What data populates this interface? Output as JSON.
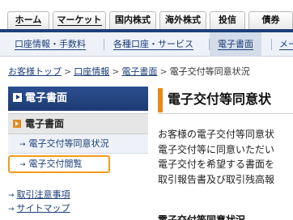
{
  "top_nav": {
    "tabs": [
      {
        "label": "ホーム"
      },
      {
        "label": "マーケット"
      },
      {
        "label": "国内株式"
      },
      {
        "label": "海外株式"
      },
      {
        "label": "投信"
      },
      {
        "label": "債券"
      }
    ]
  },
  "sub_nav": {
    "items": [
      {
        "label": "口座情報・手数料"
      },
      {
        "label": "各種口座・サービス"
      },
      {
        "label": "電子書面"
      },
      {
        "label": "メー"
      }
    ]
  },
  "breadcrumb": {
    "items": [
      "お客様トップ",
      "口座情報",
      "電子書面",
      "電子交付等同意状況"
    ],
    "separator": ">"
  },
  "sidebar": {
    "header": "電子書面",
    "group": "電子書面",
    "items": [
      {
        "label": "電子交付等同意状況"
      },
      {
        "label": "電子交付閲覧"
      }
    ],
    "links": [
      {
        "label": "取引注意事項"
      },
      {
        "label": "サイトマップ"
      }
    ]
  },
  "main": {
    "title": "電子交付等同意状",
    "body_lines": [
      "お客様の電子交付等同意状",
      "電子交付等に同意いただい",
      "電子交付を希望する書面を",
      "取引報告書及び取引残高報"
    ],
    "subheading": "電子交付等同意状況"
  },
  "colors": {
    "navy": "#1d3f7a",
    "orange": "#e68a1c",
    "link": "#1c3d78"
  }
}
